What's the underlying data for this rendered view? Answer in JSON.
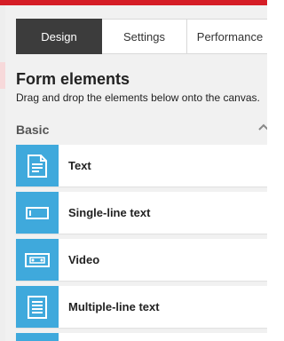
{
  "colors": {
    "accent_red": "#d51d26",
    "tile_blue": "#3fa9dc",
    "tab_active": "#3c3c3c"
  },
  "tabs": [
    {
      "label": "Design",
      "active": true
    },
    {
      "label": "Settings",
      "active": false
    },
    {
      "label": "Performance",
      "active": false
    }
  ],
  "header": {
    "title": "Form elements",
    "subtitle": "Drag and drop the elements below onto the canvas."
  },
  "section": {
    "label": "Basic",
    "icon": "chevron-up-icon"
  },
  "items": [
    {
      "label": "Text",
      "icon": "text-document-icon"
    },
    {
      "label": "Single-line text",
      "icon": "single-line-text-icon"
    },
    {
      "label": "Video",
      "icon": "video-icon"
    },
    {
      "label": "Multiple-line text",
      "icon": "multiline-text-icon"
    }
  ]
}
